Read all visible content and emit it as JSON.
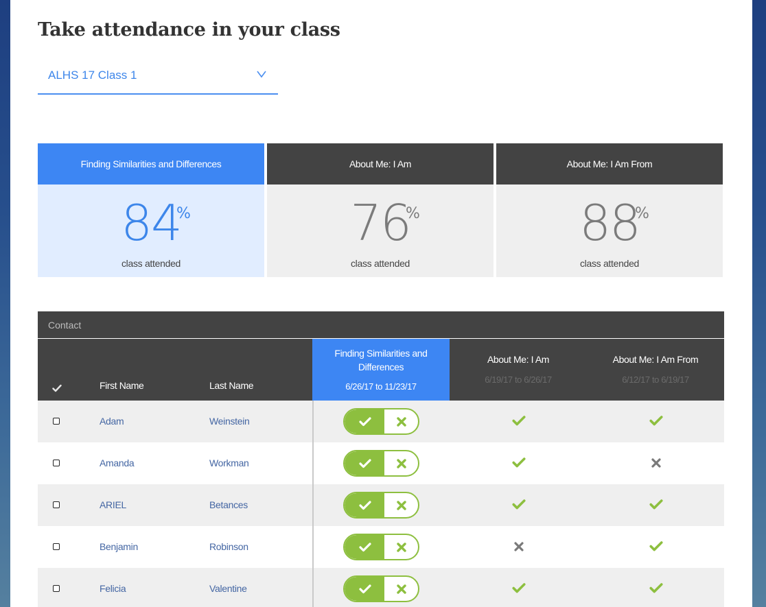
{
  "page": {
    "title": "Take attendance in your class",
    "class_select": {
      "value": "ALHS 17 Class 1"
    }
  },
  "colors": {
    "accent": "#3d86f3",
    "dark": "#434343",
    "check_green": "#8dbf3f",
    "link_blue": "#4466a3"
  },
  "cards": [
    {
      "title": "Finding Similarities and Differences",
      "percent": "84",
      "percent_sign": "%",
      "subtitle": "class attended",
      "active": true
    },
    {
      "title": "About Me: I Am",
      "percent": "76",
      "percent_sign": "%",
      "subtitle": "class attended",
      "active": false
    },
    {
      "title": "About Me: I Am From",
      "percent": "88",
      "percent_sign": "%",
      "subtitle": "class attended",
      "active": false
    }
  ],
  "table": {
    "section_label": "Contact",
    "headers": {
      "select_icon": "check-icon",
      "first_name": "First Name",
      "last_name": "Last Name",
      "lessons": [
        {
          "title": "Finding Similarities and Differences",
          "dates": "6/26/17 to 11/23/17",
          "active": true
        },
        {
          "title": "About Me: I Am",
          "dates": "6/19/17 to 6/26/17",
          "active": false
        },
        {
          "title": "About Me: I Am From",
          "dates": "6/12/17 to 6/19/17",
          "active": false
        }
      ]
    },
    "rows": [
      {
        "first": "Adam",
        "last": "Weinstein",
        "toggle": "present",
        "about_me": "present",
        "about_me_from": "present"
      },
      {
        "first": "Amanda",
        "last": "Workman",
        "toggle": "present",
        "about_me": "present",
        "about_me_from": "absent"
      },
      {
        "first": "ARIEL",
        "last": "Betances",
        "toggle": "present",
        "about_me": "present",
        "about_me_from": "present"
      },
      {
        "first": "Benjamin",
        "last": "Robinson",
        "toggle": "present",
        "about_me": "absent",
        "about_me_from": "present"
      },
      {
        "first": "Felicia",
        "last": "Valentine",
        "toggle": "present",
        "about_me": "present",
        "about_me_from": "present"
      }
    ]
  }
}
